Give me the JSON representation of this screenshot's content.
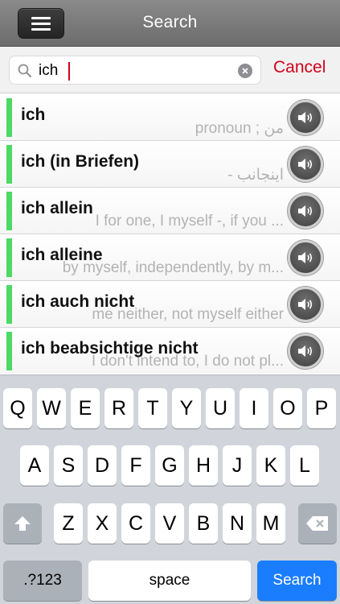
{
  "header": {
    "title": "Search",
    "menu_icon": "hamburger-menu-icon"
  },
  "search": {
    "value": "ich",
    "cancel_label": "Cancel"
  },
  "results": [
    {
      "term": "ich",
      "definition": "pronoun  ;  من",
      "rtl": false
    },
    {
      "term": "ich (in Briefen)",
      "definition": "-   اینجانب",
      "rtl": false
    },
    {
      "term": "ich allein",
      "definition": "I for one, I myself -, if you ...",
      "rtl": false
    },
    {
      "term": "ich alleine",
      "definition": "by myself, independently, by m...",
      "rtl": false
    },
    {
      "term": "ich auch nicht",
      "definition": "me neither, not myself either",
      "rtl": false
    },
    {
      "term": "ich beabsichtige nicht",
      "definition": "I don't intend to, I do not pl...",
      "rtl": false
    }
  ],
  "keyboard": {
    "row1": [
      "Q",
      "W",
      "E",
      "R",
      "T",
      "Y",
      "U",
      "I",
      "O",
      "P"
    ],
    "row2": [
      "A",
      "S",
      "D",
      "F",
      "G",
      "H",
      "J",
      "K",
      "L"
    ],
    "row3": [
      "Z",
      "X",
      "C",
      "V",
      "B",
      "N",
      "M"
    ],
    "numbers_label": ".?123",
    "space_label": "space",
    "search_label": "Search"
  },
  "colors": {
    "accent_green": "#4cd964",
    "cancel_red": "#d0021b",
    "search_key_blue": "#1a7dfe"
  }
}
